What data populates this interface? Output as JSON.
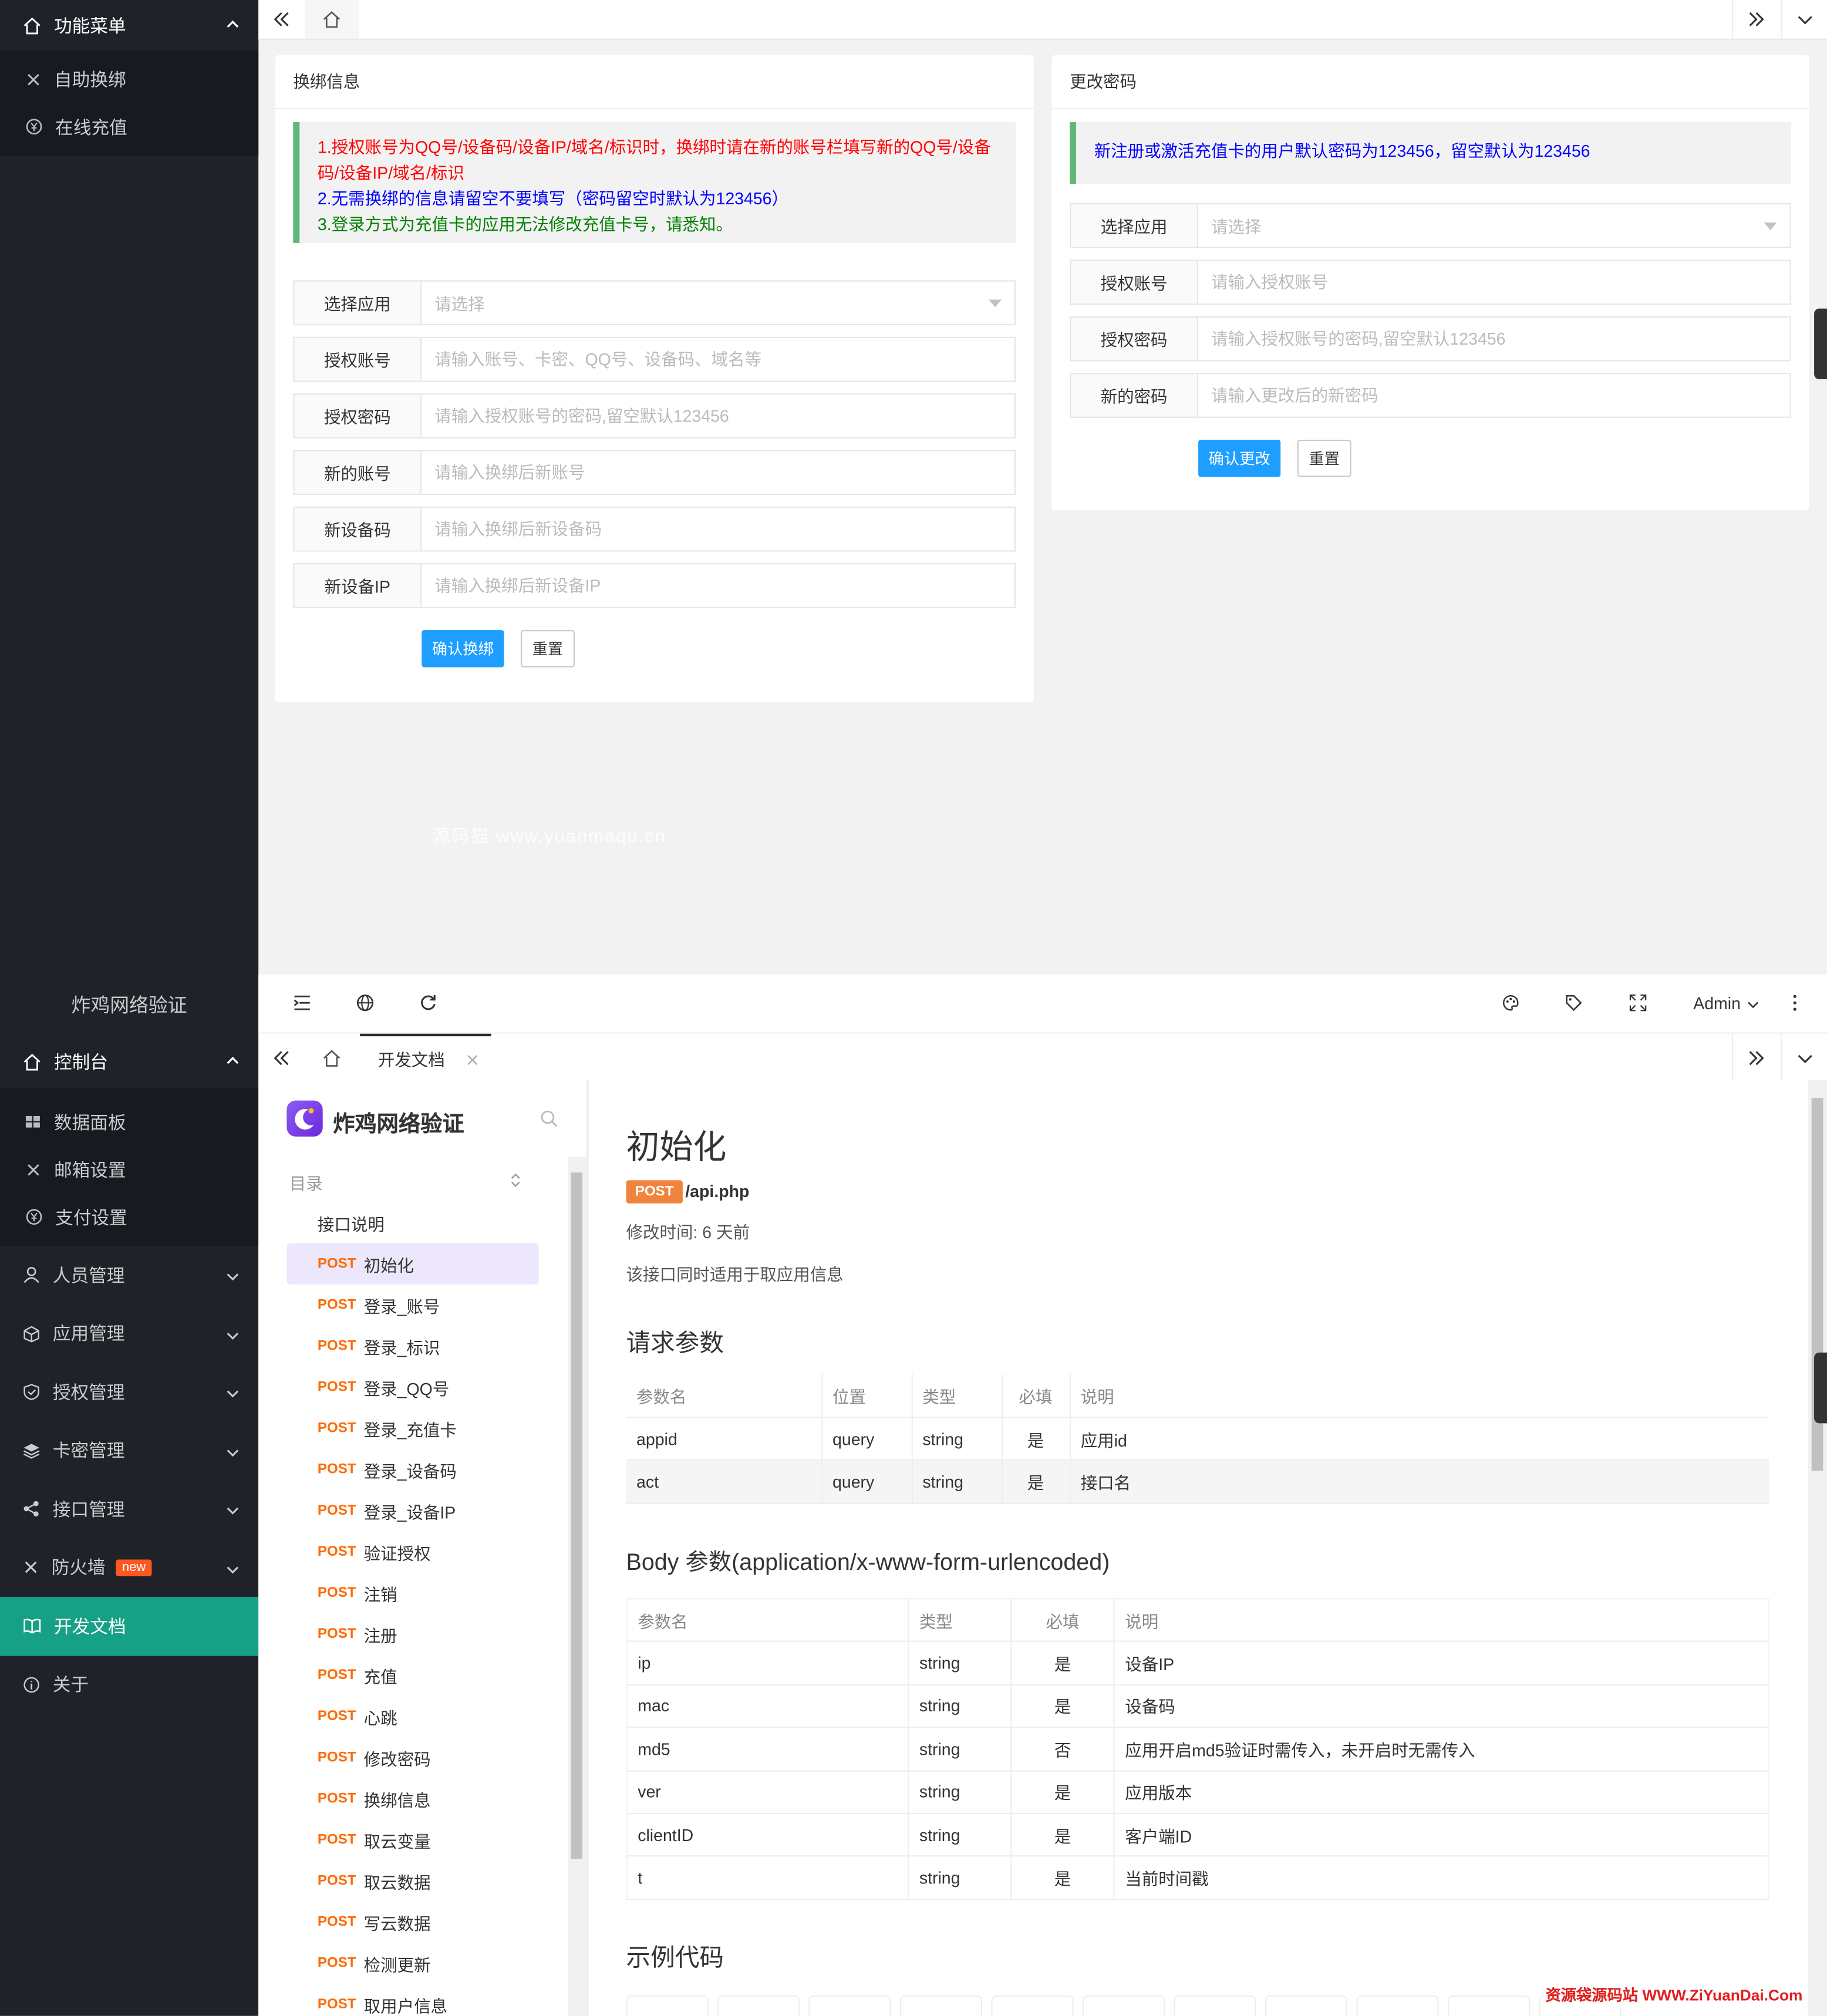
{
  "top_sidebar": {
    "menu_title": "功能菜单",
    "items": [
      {
        "label": "自助换绑"
      },
      {
        "label": "在线充值"
      }
    ]
  },
  "rebind": {
    "title": "换绑信息",
    "notes": [
      "1.授权账号为QQ号/设备码/设备IP/域名/标识时，换绑时请在新的账号栏填写新的QQ号/设备码/设备IP/域名/标识",
      "2.无需换绑的信息请留空不要填写（密码留空时默认为123456）",
      "3.登录方式为充值卡的应用无法修改充值卡号，请悉知。"
    ],
    "note_colors": [
      "#ff0000",
      "#0000ff",
      "#008000"
    ],
    "fields": [
      {
        "label": "选择应用",
        "placeholder": "请选择"
      },
      {
        "label": "授权账号",
        "placeholder": "请输入账号、卡密、QQ号、设备码、域名等"
      },
      {
        "label": "授权密码",
        "placeholder": "请输入授权账号的密码,留空默认123456"
      },
      {
        "label": "新的账号",
        "placeholder": "请输入换绑后新账号"
      },
      {
        "label": "新设备码",
        "placeholder": "请输入换绑后新设备码"
      },
      {
        "label": "新设备IP",
        "placeholder": "请输入换绑后新设备IP"
      }
    ],
    "submit": "确认换绑",
    "reset": "重置"
  },
  "password": {
    "title": "更改密码",
    "note": "新注册或激活充值卡的用户默认密码为123456，留空默认为123456",
    "fields": [
      {
        "label": "选择应用",
        "placeholder": "请选择"
      },
      {
        "label": "授权账号",
        "placeholder": "请输入授权账号"
      },
      {
        "label": "授权密码",
        "placeholder": "请输入授权账号的密码,留空默认123456"
      },
      {
        "label": "新的密码",
        "placeholder": "请输入更改后的新密码"
      }
    ],
    "submit": "确认更改",
    "reset": "重置"
  },
  "watermark": "源码猫 www.yuanmaqu.cn",
  "admin_sidebar": {
    "brand": "炸鸡网络验证",
    "console": "控制台",
    "console_items": [
      "数据面板",
      "邮箱设置",
      "支付设置"
    ],
    "nav": [
      {
        "label": "人员管理"
      },
      {
        "label": "应用管理"
      },
      {
        "label": "授权管理"
      },
      {
        "label": "卡密管理"
      },
      {
        "label": "接口管理"
      },
      {
        "label": "防火墙",
        "badge": "new"
      },
      {
        "label": "开发文档"
      },
      {
        "label": "关于"
      }
    ]
  },
  "admin_topbar": {
    "user": "Admin"
  },
  "admin_tabs": {
    "active": "开发文档"
  },
  "docs": {
    "brand": "炸鸡网络验证",
    "toc_label": "目录",
    "intro": "接口说明",
    "method": "POST",
    "toc": [
      "初始化",
      "登录_账号",
      "登录_标识",
      "登录_QQ号",
      "登录_充值卡",
      "登录_设备码",
      "登录_设备IP",
      "验证授权",
      "注销",
      "注册",
      "充值",
      "心跳",
      "修改密码",
      "换绑信息",
      "取云变量",
      "取云数据",
      "写云数据",
      "检测更新",
      "取用户信息"
    ],
    "title": "初始化",
    "path": "/api.php",
    "modified": "修改时间: 6 天前",
    "desc": "该接口同时适用于取应用信息",
    "req_title": "请求参数",
    "req_headers": [
      "参数名",
      "位置",
      "类型",
      "必填",
      "说明"
    ],
    "req_rows": [
      [
        "appid",
        "query",
        "string",
        "是",
        "应用id"
      ],
      [
        "act",
        "query",
        "string",
        "是",
        "接口名"
      ]
    ],
    "body_title": "Body 参数(application/x-www-form-urlencoded)",
    "body_headers": [
      "参数名",
      "类型",
      "必填",
      "说明"
    ],
    "body_rows": [
      [
        "ip",
        "string",
        "是",
        "设备IP"
      ],
      [
        "mac",
        "string",
        "是",
        "设备码"
      ],
      [
        "md5",
        "string",
        "否",
        "应用开启md5验证时需传入，未开启时无需传入"
      ],
      [
        "ver",
        "string",
        "是",
        "应用版本"
      ],
      [
        "clientID",
        "string",
        "是",
        "客户端ID"
      ],
      [
        "t",
        "string",
        "是",
        "当前时间戳"
      ]
    ],
    "example_title": "示例代码"
  },
  "footer_watermark": "资源袋源码站 WWW.ZiYuanDai.Com"
}
